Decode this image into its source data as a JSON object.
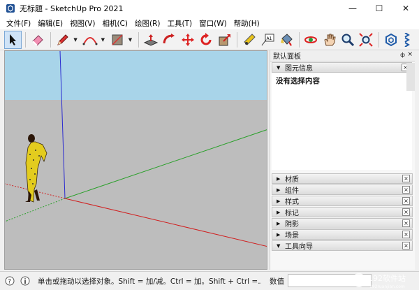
{
  "window": {
    "title": "无标题 - SketchUp Pro 2021",
    "minimize": "—",
    "maximize": "☐",
    "close": "✕"
  },
  "menu": [
    "文件(F)",
    "编辑(E)",
    "视图(V)",
    "相机(C)",
    "绘图(R)",
    "工具(T)",
    "窗口(W)",
    "帮助(H)"
  ],
  "toolbar": {
    "tools": [
      "select-icon",
      "eraser-icon",
      "pencil-icon",
      "arc-icon",
      "rectangle-icon",
      "push-pull-icon",
      "follow-me-icon",
      "move-icon",
      "rotate-icon",
      "scale-icon",
      "tape-measure-icon",
      "text-icon",
      "paint-bucket-icon",
      "orbit-icon",
      "pan-icon",
      "zoom-icon",
      "zoom-extents-icon",
      "warehouse-icon",
      "extension-icon"
    ],
    "text_tool_label": "A1"
  },
  "panel": {
    "title": "默认面板",
    "pin": "ф",
    "close": "×",
    "entity_info": {
      "label": "图元信息",
      "content": "没有选择内容"
    },
    "trays": [
      {
        "label": "材质",
        "expanded": false
      },
      {
        "label": "组件",
        "expanded": false
      },
      {
        "label": "样式",
        "expanded": false
      },
      {
        "label": "标记",
        "expanded": false
      },
      {
        "label": "阴影",
        "expanded": false
      },
      {
        "label": "场景",
        "expanded": false
      },
      {
        "label": "工具向导",
        "expanded": true
      }
    ]
  },
  "status": {
    "text": "单击或拖动以选择对象。Shift = 加/减。Ctrl = 加。Shift + Ctrl =...",
    "measurements_label": "数值"
  },
  "watermark": {
    "text": "192软件站",
    "subtext": "192ruanjian.com"
  },
  "colors": {
    "sky": "#a8d4e9",
    "ground": "#bdbdbd",
    "axis_red": "#d02020",
    "axis_green": "#2aa02a",
    "axis_blue": "#2a2ad0",
    "selected_tool": "#cfe3f7"
  }
}
